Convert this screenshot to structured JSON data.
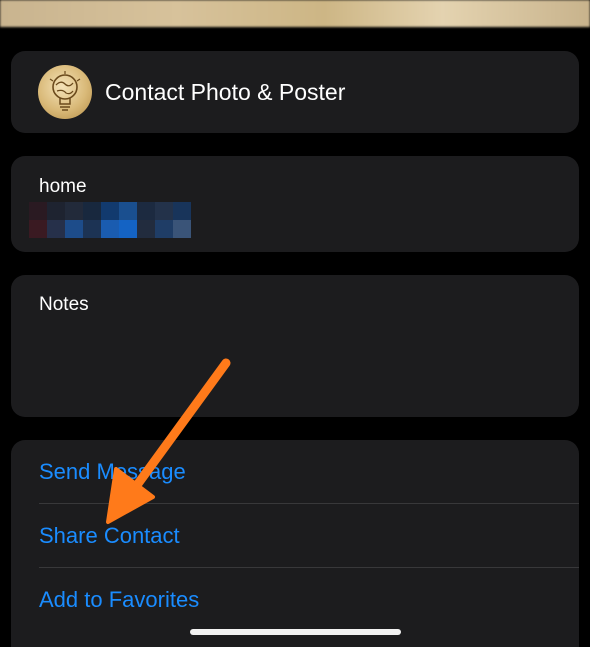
{
  "contact_photo": {
    "label": "Contact Photo & Poster",
    "avatar_icon": "lightbulb-globe-icon"
  },
  "home": {
    "label": "home"
  },
  "notes": {
    "label": "Notes"
  },
  "actions": [
    {
      "label": "Send Message"
    },
    {
      "label": "Share Contact"
    },
    {
      "label": "Add to Favorites"
    }
  ],
  "colors": {
    "background": "#000000",
    "card": "#1c1c1e",
    "accent": "#1a8cff",
    "arrow": "#ff7a1a"
  }
}
